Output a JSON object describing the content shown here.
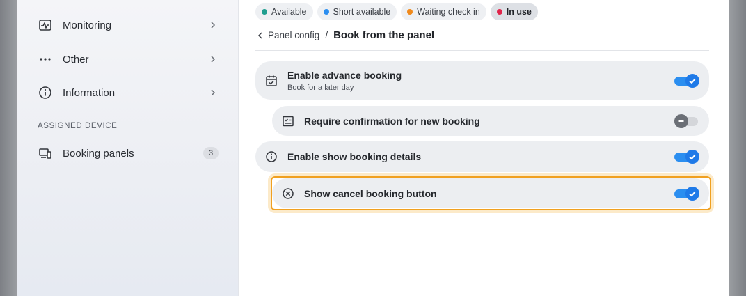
{
  "sidebar": {
    "items": [
      {
        "label": "Monitoring",
        "icon": "monitoring-icon"
      },
      {
        "label": "Other",
        "icon": "more-dots-icon"
      },
      {
        "label": "Information",
        "icon": "info-icon"
      }
    ],
    "section_title": "ASSIGNED DEVICE",
    "device_item": {
      "label": "Booking panels",
      "count": "3",
      "icon": "devices-icon"
    }
  },
  "legend": [
    {
      "label": "Available",
      "color": "#1f9e8f"
    },
    {
      "label": "Short available",
      "color": "#2b8ef0"
    },
    {
      "label": "Waiting check in",
      "color": "#f08a1c"
    },
    {
      "label": "In use",
      "color": "#e0244a"
    }
  ],
  "breadcrumb": {
    "back_label": "Panel config",
    "separator": "/",
    "current": "Book from the panel"
  },
  "settings": [
    {
      "title": "Enable advance booking",
      "subtitle": "Book for a later day",
      "enabled": true
    },
    {
      "title": "Require confirmation for new booking",
      "enabled": false
    },
    {
      "title": "Enable show booking details",
      "enabled": true
    },
    {
      "title": "Show cancel booking button",
      "enabled": true,
      "focused": true
    }
  ],
  "colors": {
    "accent": "#1f7ae8",
    "focus": "#f0a020"
  }
}
